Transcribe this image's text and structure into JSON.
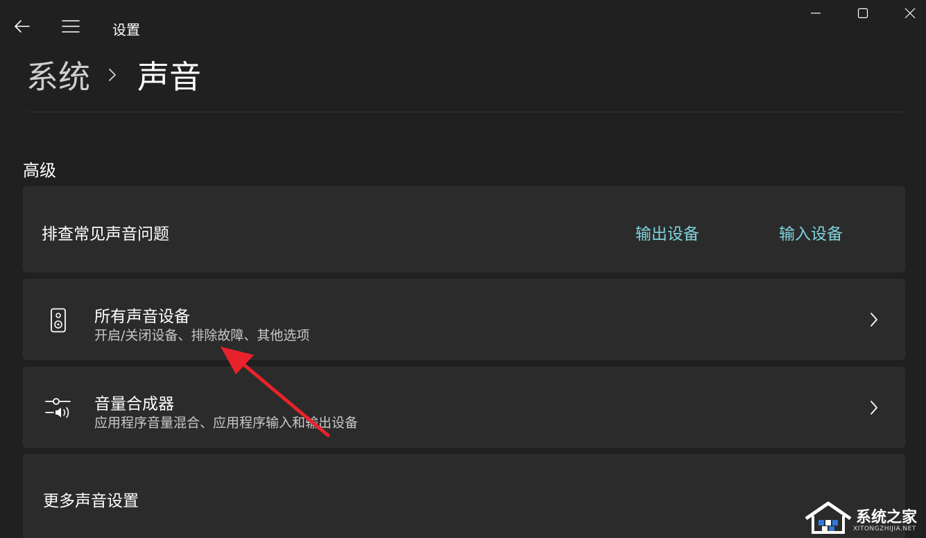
{
  "window": {
    "title": "设置"
  },
  "breadcrumb": {
    "parent": "系统",
    "current": "声音"
  },
  "section": {
    "title": "高级"
  },
  "troubleshoot": {
    "label": "排查常见声音问题",
    "links": [
      "输出设备",
      "输入设备"
    ]
  },
  "items": [
    {
      "title": "所有声音设备",
      "subtitle": "开启/关闭设备、排除故障、其他选项",
      "icon": "speaker-icon"
    },
    {
      "title": "音量合成器",
      "subtitle": "应用程序音量混合、应用程序输入和输出设备",
      "icon": "volume-mixer-icon"
    }
  ],
  "more": {
    "label": "更多声音设置"
  },
  "watermark": {
    "text": "系统之家",
    "url": "XITONGZHIJIA.NET"
  },
  "colors": {
    "background": "#202020",
    "card": "#2b2b2b",
    "accent_link": "#7fd3de",
    "annotation_arrow": "#e8222b"
  }
}
